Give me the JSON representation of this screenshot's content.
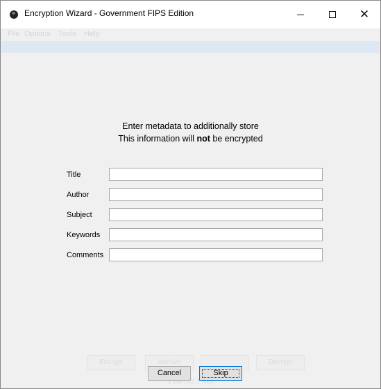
{
  "window": {
    "title": "Encryption Wizard - Government FIPS Edition",
    "icon": "app-eye-icon",
    "controls": {
      "minimize": "minimize-icon",
      "maximize": "maximize-icon",
      "close": "close-icon"
    }
  },
  "menubar": {
    "items": [
      "File",
      "Options",
      "Tools",
      "Help"
    ]
  },
  "dialog": {
    "heading_line1": "Enter metadata to additionally store",
    "heading_line2_pre": "This information will ",
    "heading_line2_bold": "not",
    "heading_line2_post": " be encrypted",
    "fields": [
      {
        "label": "Title",
        "value": ""
      },
      {
        "label": "Author",
        "value": ""
      },
      {
        "label": "Subject",
        "value": ""
      },
      {
        "label": "Keywords",
        "value": ""
      },
      {
        "label": "Comments",
        "value": ""
      }
    ],
    "buttons": {
      "cancel": "Cancel",
      "skip": "Skip"
    }
  },
  "background": {
    "buttons": [
      "Encrypt",
      "Archive",
      "",
      "Decrypt"
    ],
    "status": "1 file (12.1 KB)"
  },
  "colors": {
    "focus_border": "#0078d7",
    "path_bar": "#dde8f3"
  }
}
